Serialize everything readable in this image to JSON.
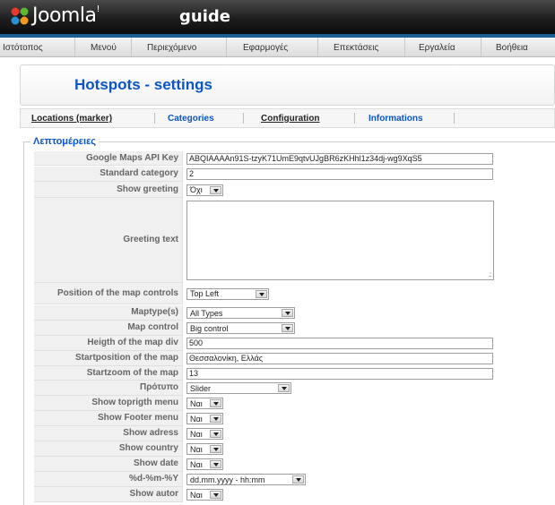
{
  "header": {
    "brand": "Joomla!",
    "brand_main": "Joomla",
    "brand_tm": "!",
    "subtitle": "guide"
  },
  "menu": {
    "items": [
      "Ιστότοπος",
      "Μενού",
      "Περιεχόμενο",
      "Εφαρμογές",
      "Επεκτάσεις",
      "Εργαλεία",
      "Βοήθεια"
    ]
  },
  "page": {
    "title": "Hotspots - settings"
  },
  "tabs": {
    "items": [
      "Locations (marker)",
      "Categories",
      "Configuration",
      "Informations"
    ],
    "current": [
      "Locations (marker)",
      "Configuration"
    ]
  },
  "fieldset": {
    "legend": "Λεπτομέρειες"
  },
  "settings": {
    "google_maps_api_key": {
      "label": "Google Maps API Key",
      "value": "ABQIAAAAn91S-tzyK71UmE9qtvUJgBR6zKHhl1z34dj-wg9XqS5"
    },
    "standard_category": {
      "label": "Standard category",
      "value": "2"
    },
    "show_greeting": {
      "label": "Show greeting",
      "value": "Όχι"
    },
    "greeting_text": {
      "label": "Greeting text",
      "value": ""
    },
    "position_map_controls": {
      "label": "Position of the map controls",
      "value": "Top Left"
    },
    "maptypes": {
      "label": "Maptype(s)",
      "value": "All Types"
    },
    "map_control": {
      "label": "Map control",
      "value": "Big control"
    },
    "heigth_map_div": {
      "label": "Heigth of the map div",
      "value": "500"
    },
    "startposition_map": {
      "label": "Startposition of the map",
      "value": "Θεσσαλονίκη, Ελλάς"
    },
    "startzoom_map": {
      "label": "Startzoom of the map",
      "value": "13"
    },
    "template": {
      "label": "Πρότυπο",
      "value": "Slider"
    },
    "show_toprigth_menu": {
      "label": "Show toprigth menu",
      "value": "Ναι"
    },
    "show_footer_menu": {
      "label": "Show Footer menu",
      "value": "Ναι"
    },
    "show_adress": {
      "label": "Show adress",
      "value": "Ναι"
    },
    "show_country": {
      "label": "Show country",
      "value": "Ναι"
    },
    "show_date": {
      "label": "Show date",
      "value": "Ναι"
    },
    "date_format": {
      "label": "%d-%m-%Y",
      "value": "dd.mm.yyyy - hh:mm"
    },
    "show_autor": {
      "label": "Show autor",
      "value": "Ναι"
    }
  },
  "colors": {
    "header_bg": "#111111",
    "menu_accent": "#1b5f99",
    "title_blue": "#0b55c4",
    "logo_green": "#5cb82e",
    "logo_orange": "#f49a1a",
    "logo_red": "#e6392b",
    "logo_blue": "#2a8fd1"
  },
  "icons": {
    "logo": "joomla-logo-icon",
    "dropdown": "chevron-down-icon"
  }
}
